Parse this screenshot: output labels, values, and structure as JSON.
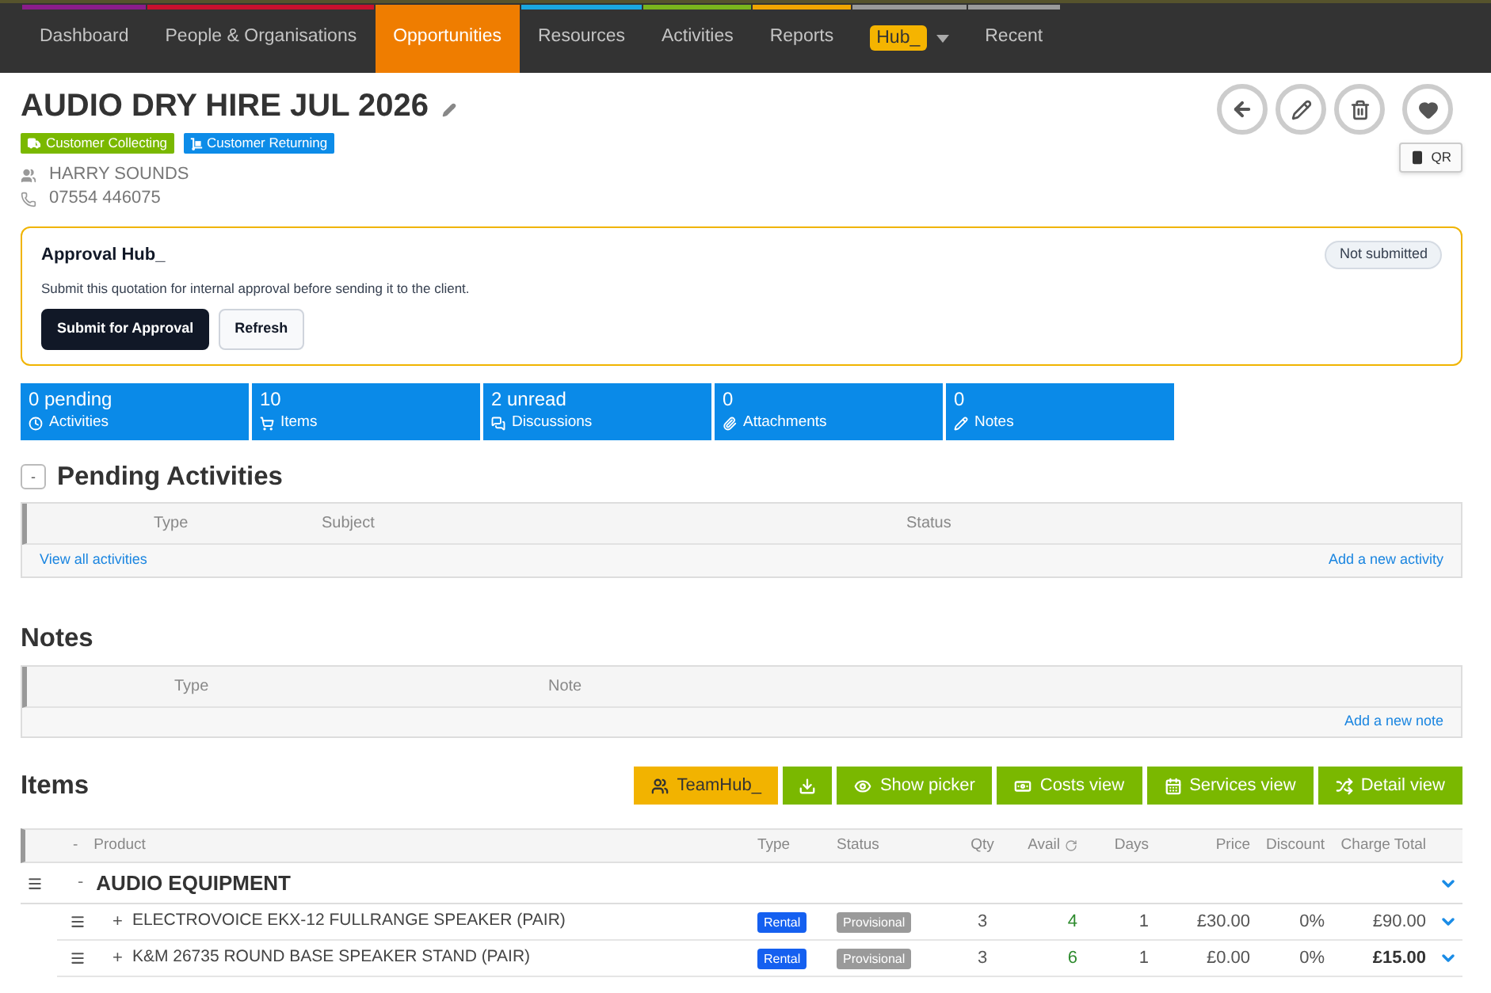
{
  "nav": {
    "items": [
      {
        "label": "Dashboard",
        "kind": "link",
        "selected": false,
        "color": "#8b1d8b"
      },
      {
        "label": "People & Organisations",
        "kind": "link",
        "selected": false,
        "color": "#c8102e"
      },
      {
        "label": "Opportunities",
        "kind": "link",
        "selected": true,
        "color": "#ef7d00"
      },
      {
        "label": "Resources",
        "kind": "link",
        "selected": false,
        "color": "#1aa7e0"
      },
      {
        "label": "Activities",
        "kind": "link",
        "selected": false,
        "color": "#7ab51d"
      },
      {
        "label": "Reports",
        "kind": "link",
        "selected": false,
        "color": "#f0a500"
      },
      {
        "label": "Hub_",
        "kind": "badge",
        "selected": false,
        "color": "#9a9a9a"
      },
      {
        "label": "Recent",
        "kind": "link",
        "selected": false,
        "color": "#9a9a9a"
      }
    ]
  },
  "header": {
    "title": "AUDIO DRY HIRE JUL 2026",
    "tags": [
      {
        "label": "Customer Collecting",
        "kind": "collecting",
        "color": "#7ab800"
      },
      {
        "label": "Customer Returning",
        "kind": "returning",
        "color": "#0d8ce8"
      }
    ],
    "contact": "HARRY SOUNDS",
    "phone": "07554 446075",
    "qr_button": "QR"
  },
  "approval": {
    "title": "Approval Hub_",
    "status": "Not submitted",
    "description": "Submit this quotation for internal approval before sending it to the client.",
    "buttons": [
      {
        "label": "Submit for Approval",
        "kind": "primary"
      },
      {
        "label": "Refresh",
        "kind": "secondary"
      }
    ]
  },
  "summary": [
    {
      "value": "0 pending",
      "label": "Activities",
      "kind": "activities"
    },
    {
      "value": "10",
      "label": "Items",
      "kind": "items"
    },
    {
      "value": "2 unread",
      "label": "Discussions",
      "kind": "discussions"
    },
    {
      "value": "0",
      "label": "Attachments",
      "kind": "attachments"
    },
    {
      "value": "0",
      "label": "Notes",
      "kind": "notes"
    }
  ],
  "pending_activities": {
    "toggle": "-",
    "title": "Pending Activities",
    "columns": [
      "Type",
      "Subject",
      "Status"
    ],
    "view_all_link": "View all activities",
    "add_link": "Add a new activity"
  },
  "notes": {
    "title": "Notes",
    "columns": [
      "Type",
      "Note"
    ],
    "add_link": "Add a new note"
  },
  "items": {
    "title": "Items",
    "toolbar": [
      {
        "kind": "teamhub",
        "label": "TeamHub_"
      },
      {
        "kind": "download"
      },
      {
        "kind": "picker",
        "label": "Show picker"
      },
      {
        "kind": "costs",
        "label": "Costs view"
      },
      {
        "kind": "services",
        "label": "Services view"
      },
      {
        "kind": "detail",
        "label": "Detail view"
      }
    ],
    "toggle": "-",
    "columns": [
      "Product",
      "Type",
      "Status",
      "Qty",
      "Avail",
      "Days",
      "Price",
      "Discount",
      "Charge Total"
    ],
    "groups": [
      {
        "toggle": "-",
        "name": "AUDIO EQUIPMENT",
        "rows": [
          {
            "toggle": "+",
            "name": "ELECTROVOICE EKX-12 FULLRANGE SPEAKER (PAIR)",
            "type": "Rental",
            "status": "Provisional",
            "qty": "3",
            "avail": "4",
            "days": "1",
            "price": "£30.00",
            "discount": "0%",
            "charge_total": "£90.00",
            "total_bold": false
          },
          {
            "toggle": "+",
            "name": "K&M 26735 ROUND BASE SPEAKER STAND (PAIR)",
            "type": "Rental",
            "status": "Provisional",
            "qty": "3",
            "avail": "6",
            "days": "1",
            "price": "£0.00",
            "discount": "0%",
            "charge_total": "£15.00",
            "total_bold": true
          }
        ]
      }
    ]
  }
}
